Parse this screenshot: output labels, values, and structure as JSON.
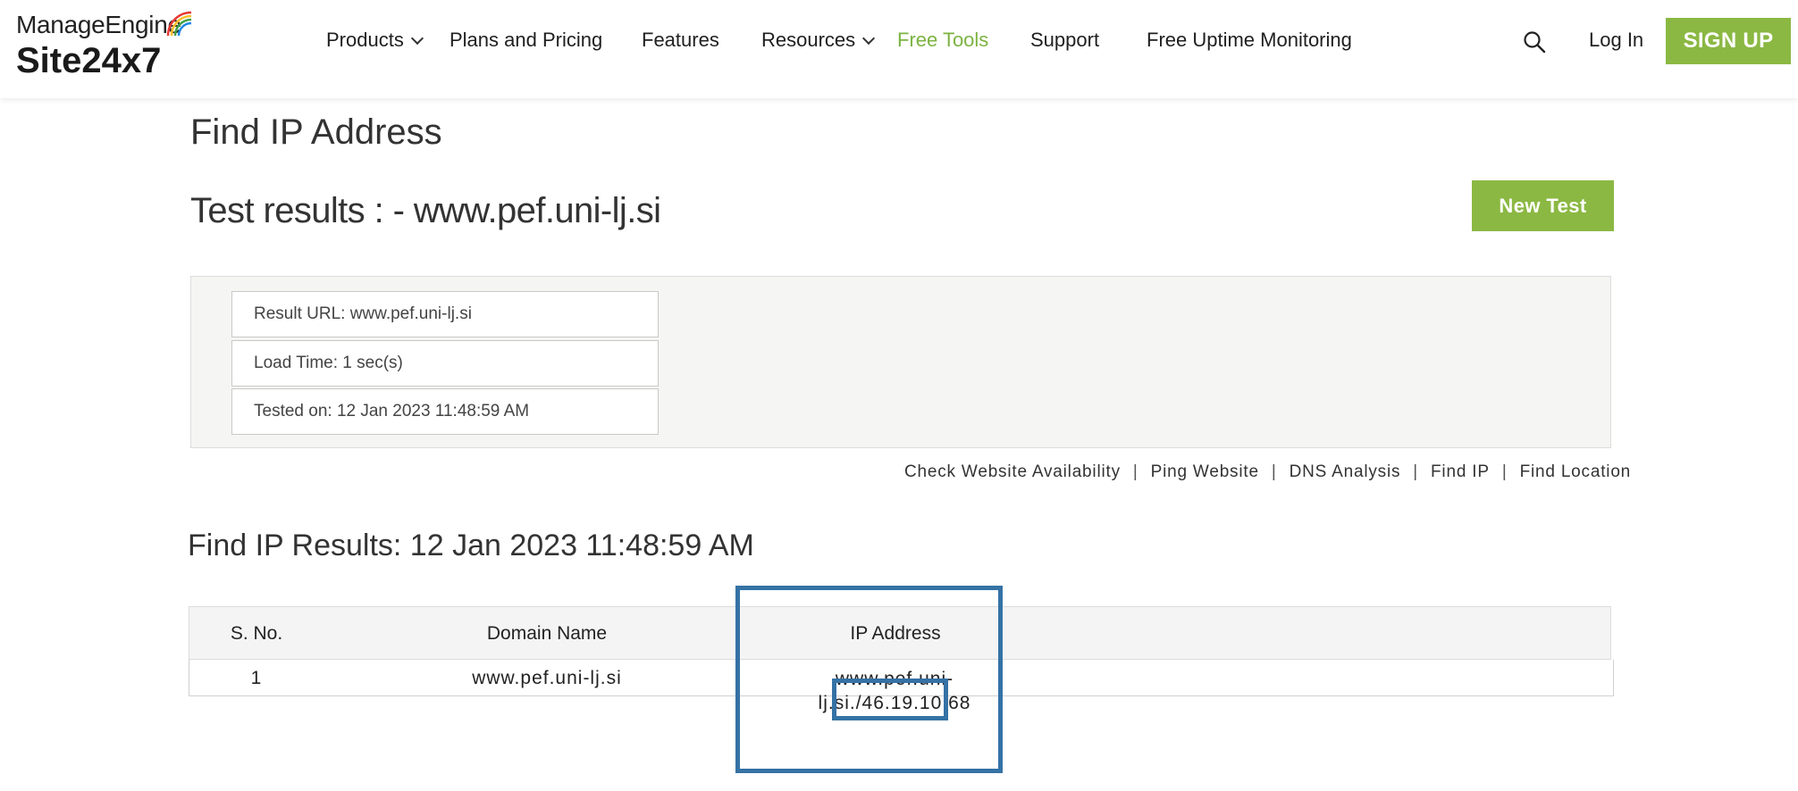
{
  "header": {
    "brand": "ManageEngine",
    "product": "Site24x7",
    "nav": [
      {
        "label": "Products",
        "dropdown": true
      },
      {
        "label": "Plans and Pricing",
        "dropdown": false
      },
      {
        "label": "Features",
        "dropdown": false
      },
      {
        "label": "Resources",
        "dropdown": true
      },
      {
        "label": "Free Tools",
        "dropdown": false,
        "active": true
      },
      {
        "label": "Support",
        "dropdown": false
      },
      {
        "label": "Free Uptime Monitoring",
        "dropdown": false
      }
    ],
    "search_icon": "search-icon",
    "login_label": "Log In",
    "signup_label": "SIGN UP"
  },
  "main": {
    "page_title": "Find IP Address",
    "results_title": "Test results : - www.pef.uni-lj.si",
    "new_test_label": "New Test",
    "summary": [
      "Result URL: www.pef.uni-lj.si",
      "Load Time: 1 sec(s)",
      "Tested on: 12 Jan 2023 11:48:59 AM"
    ],
    "tool_links": [
      "Check Website Availability",
      "Ping Website",
      "DNS Analysis",
      "Find IP",
      "Find Location"
    ],
    "tool_link_separator": "|",
    "ip_results_title": "Find IP Results: 12 Jan 2023 11:48:59 AM",
    "table": {
      "headers": [
        "S. No.",
        "Domain Name",
        "IP Address"
      ],
      "rows": [
        {
          "sno": "1",
          "domain": "www.pef.uni-lj.si",
          "ip_line1": "www.pef.uni-",
          "ip_line2": "lj.si./46.19.10.68"
        }
      ]
    }
  },
  "colors": {
    "accent_green": "#8bb843",
    "free_tools_green": "#7cb342",
    "highlight_blue": "#3572a5"
  }
}
